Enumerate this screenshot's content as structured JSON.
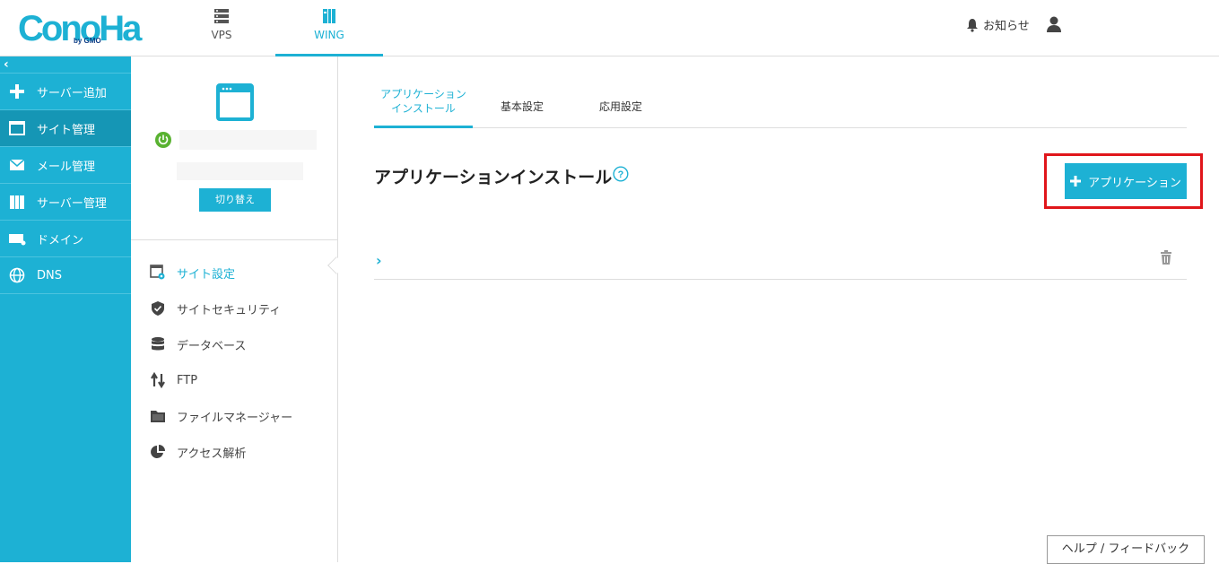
{
  "header": {
    "logo_text": "ConoHa",
    "logo_sub": "by GMO",
    "tabs": [
      {
        "label": "VPS",
        "icon": "server-icon"
      },
      {
        "label": "WING",
        "icon": "wing-icon"
      }
    ],
    "notice_label": "お知らせ"
  },
  "leftnav": {
    "collapse": "‹",
    "items": [
      {
        "label": "サーバー追加",
        "icon": "plus-icon"
      },
      {
        "label": "サイト管理",
        "icon": "window-icon"
      },
      {
        "label": "メール管理",
        "icon": "mail-icon"
      },
      {
        "label": "サーバー管理",
        "icon": "server-manage-icon"
      },
      {
        "label": "ドメイン",
        "icon": "domain-icon"
      },
      {
        "label": "DNS",
        "icon": "globe-icon"
      }
    ]
  },
  "site": {
    "switch_label": "切り替え",
    "subnav": [
      {
        "label": "サイト設定",
        "icon": "site-settings-icon"
      },
      {
        "label": "サイトセキュリティ",
        "icon": "shield-icon"
      },
      {
        "label": "データベース",
        "icon": "database-icon"
      },
      {
        "label": "FTP",
        "icon": "ftp-icon"
      },
      {
        "label": "ファイルマネージャー",
        "icon": "folder-icon"
      },
      {
        "label": "アクセス解析",
        "icon": "pie-chart-icon"
      }
    ]
  },
  "main": {
    "tabs": [
      {
        "label_line1": "アプリケーション",
        "label_line2": "インストール"
      },
      {
        "label_line1": "基本設定",
        "label_line2": ""
      },
      {
        "label_line1": "応用設定",
        "label_line2": ""
      }
    ],
    "title": "アプリケーションインストール",
    "add_button_label": "アプリケーション",
    "feedback_label": "ヘルプ / フィードバック"
  },
  "colors": {
    "accent": "#1db1d4",
    "nav_active": "#1596b5",
    "highlight": "#e0161b"
  }
}
